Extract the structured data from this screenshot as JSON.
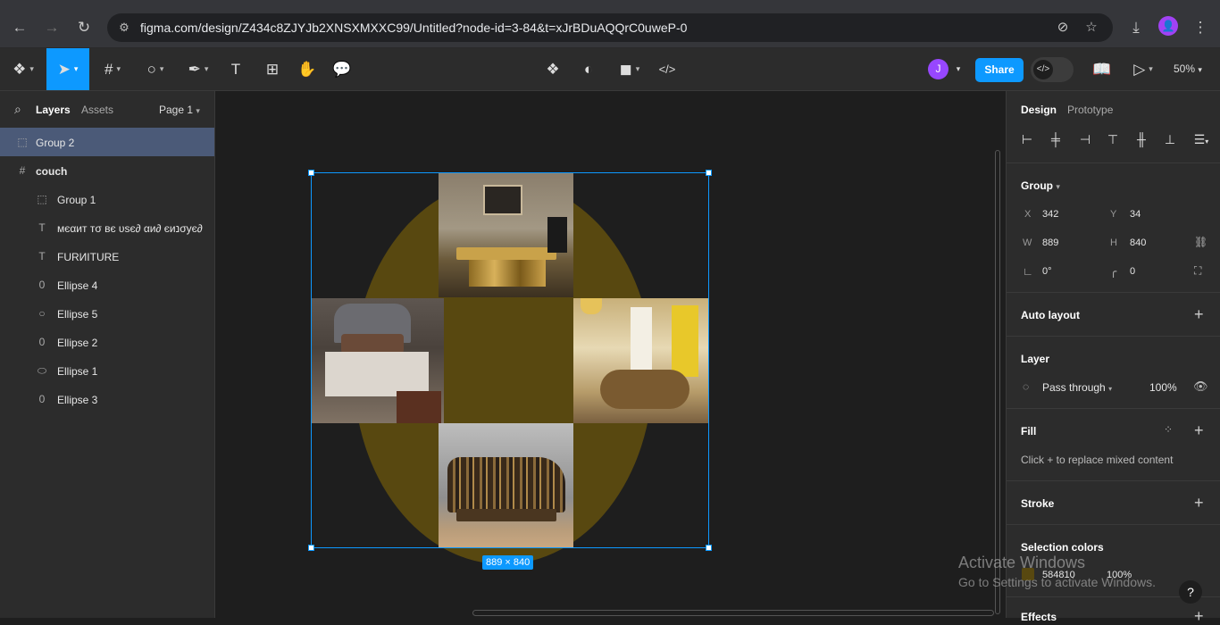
{
  "browser": {
    "url": "figma.com/design/Z434c8ZJYJb2XNSXMXXC99/Untitled?node-id=3-84&t=xJrBDuAQQrC0uweP-0",
    "profile_initial": "👤"
  },
  "toolbar": {
    "avatar_initial": "J",
    "share_label": "Share",
    "zoom": "50%"
  },
  "left_panel": {
    "tab_layers": "Layers",
    "tab_assets": "Assets",
    "page_selector": "Page 1",
    "layers": [
      {
        "label": "Group 2",
        "icon": "group-icon",
        "selected": true
      },
      {
        "label": "couch",
        "icon": "frame-icon",
        "bold": true
      },
      {
        "label": "Group 1",
        "icon": "group-icon"
      },
      {
        "label": "мєαит тσ вє υѕє∂ αи∂ єиנσує∂",
        "icon": "text-icon"
      },
      {
        "label": "FURИITURE",
        "icon": "text-icon"
      },
      {
        "label": "Ellipse 4",
        "icon": "ellipse-icon"
      },
      {
        "label": "Ellipse 5",
        "icon": "ellipse-icon"
      },
      {
        "label": "Ellipse 2",
        "icon": "ellipse-icon"
      },
      {
        "label": "Ellipse 1",
        "icon": "ellipse-icon"
      },
      {
        "label": "Ellipse 3",
        "icon": "ellipse-icon"
      }
    ]
  },
  "canvas": {
    "selection_size": "889 × 840",
    "ellipse_color": "#584810"
  },
  "right_panel": {
    "tab_design": "Design",
    "tab_prototype": "Prototype",
    "group_label": "Group",
    "x_label": "X",
    "x_value": "342",
    "y_label": "Y",
    "y_value": "34",
    "w_label": "W",
    "w_value": "889",
    "h_label": "H",
    "h_value": "840",
    "rotation": "0°",
    "radius": "0",
    "auto_layout": "Auto layout",
    "layer": "Layer",
    "blend_mode": "Pass through",
    "opacity": "100%",
    "fill": "Fill",
    "fill_hint": "Click + to replace mixed content",
    "stroke": "Stroke",
    "selection_colors": "Selection colors",
    "sel_color_hex": "584810",
    "sel_color_opacity": "100%",
    "effects": "Effects"
  },
  "watermark": {
    "title": "Activate Windows",
    "subtitle": "Go to Settings to activate Windows."
  },
  "help": "?"
}
